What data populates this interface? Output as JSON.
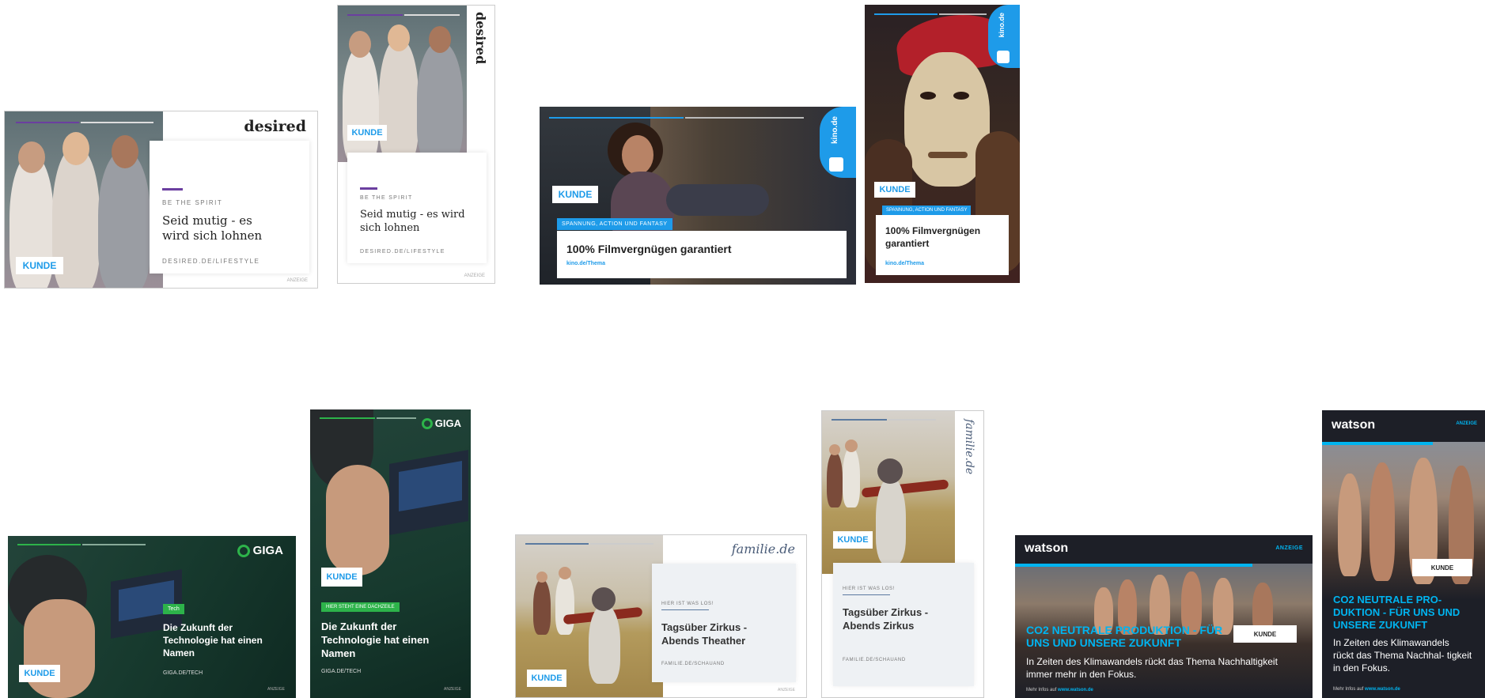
{
  "desired": {
    "brand": "desired",
    "eyebrow": "BE THE SPIRIT",
    "headline": "Seid mutig - es wird sich lohnen",
    "url": "DESIRED.DE/LIFESTYLE",
    "client": "KUNDE",
    "ad_label": "ANZEIGE",
    "accent": "#6b3fa0"
  },
  "kino": {
    "brand": "kino.de",
    "tag": "SPANNUNG, ACTION UND FANTASY",
    "headline": "100% Filmvergnügen garantiert",
    "url": "kino.de/Thema",
    "client": "KUNDE",
    "accent": "#1e9be9"
  },
  "giga": {
    "brand": "GIGA",
    "tag_wide": "Tech",
    "tag_tall": "HIER STEHT EINE DACHZEILE",
    "headline": "Die Zukunft der Technologie hat einen Namen",
    "url": "GIGA.DE/TECH",
    "client": "KUNDE",
    "ad_label": "ANZEIGE",
    "accent": "#2db34a"
  },
  "familie": {
    "brand": "familie.de",
    "eyebrow": "HIER IST WAS LOS!",
    "headline_wide": "Tagsüber Zirkus - Abends Theather",
    "headline_tall": "Tagsüber Zirkus - Abends Zirkus",
    "url": "FAMILIE.DE/SCHAUAND",
    "client": "KUNDE",
    "ad_label": "ANZEIGE",
    "accent": "#5b7aa0"
  },
  "watson": {
    "brand": "watson",
    "ad_label": "ANZEIGE",
    "headline_wide": "CO2 NEUTRALE PRODUKTION - FÜR UNS UND UNSERE ZUKUNFT",
    "headline_tall": "CO2 NEUTRALE PRO- DUKTION - FÜR UNS UND UNSERE ZUKUNFT",
    "body_wide": "In Zeiten des Klimawandels rückt das Thema Nachhaltigkeit immer mehr in den Fokus.",
    "body_tall": "In Zeiten des Klimawandels rückt das Thema Nachhal- tigkeit in den Fokus.",
    "more_prefix": "Mehr Infos auf",
    "more_link": "www.watson.de",
    "client": "KUNDE",
    "accent": "#00b4f0"
  }
}
